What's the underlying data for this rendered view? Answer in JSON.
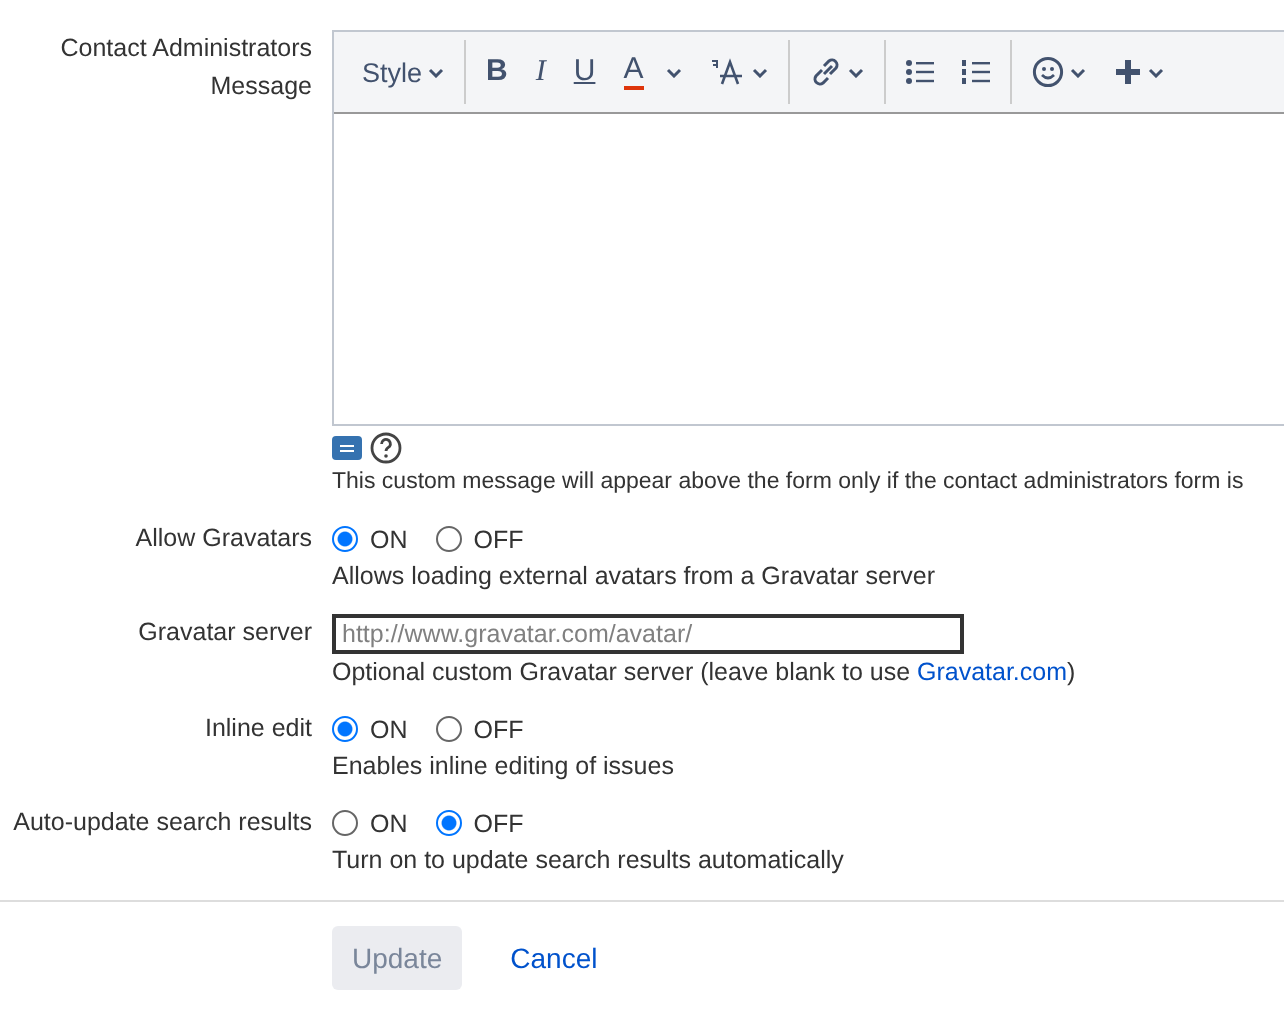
{
  "contact_message": {
    "label": "Contact Administrators Message",
    "toolbar": [
      [
        {
          "kind": "dropdown",
          "label": "Style"
        }
      ],
      [
        {
          "kind": "bold",
          "label": "B"
        },
        {
          "kind": "italic",
          "label": "I"
        },
        {
          "kind": "underline",
          "label": "U"
        },
        {
          "kind": "color",
          "label": "A"
        },
        {
          "kind": "text-size"
        }
      ],
      [
        {
          "kind": "link"
        }
      ],
      [
        {
          "kind": "bullet-list"
        },
        {
          "kind": "numbered-list"
        }
      ],
      [
        {
          "kind": "emoji"
        },
        {
          "kind": "plus"
        }
      ]
    ],
    "description": "This custom message will appear above the form only if the contact administrators form is"
  },
  "settings": [
    {
      "kind": "radio",
      "label": "Allow Gravatars",
      "options": [
        {
          "label": "ON",
          "selected": true
        },
        {
          "label": "OFF",
          "selected": false
        }
      ],
      "description": "Allows loading external avatars from a Gravatar server"
    },
    {
      "kind": "text",
      "label": "Gravatar server",
      "placeholder": "http://www.gravatar.com/avatar/",
      "description": "Optional custom Gravatar server (leave blank to use ",
      "link": "Gravatar.com",
      "description_end": ")"
    },
    {
      "kind": "radio",
      "label": "Inline edit",
      "options": [
        {
          "label": "ON",
          "selected": true
        },
        {
          "label": "OFF",
          "selected": false
        }
      ],
      "description": "Enables inline editing of issues"
    },
    {
      "kind": "radio",
      "label": "Auto-update search results",
      "options": [
        {
          "label": "ON",
          "selected": false
        },
        {
          "label": "OFF",
          "selected": true
        }
      ],
      "description": "Turn on to update search results automatically"
    }
  ],
  "buttons": [
    {
      "kind": "button",
      "label": "Update"
    },
    {
      "kind": "link",
      "label": "Cancel"
    }
  ]
}
